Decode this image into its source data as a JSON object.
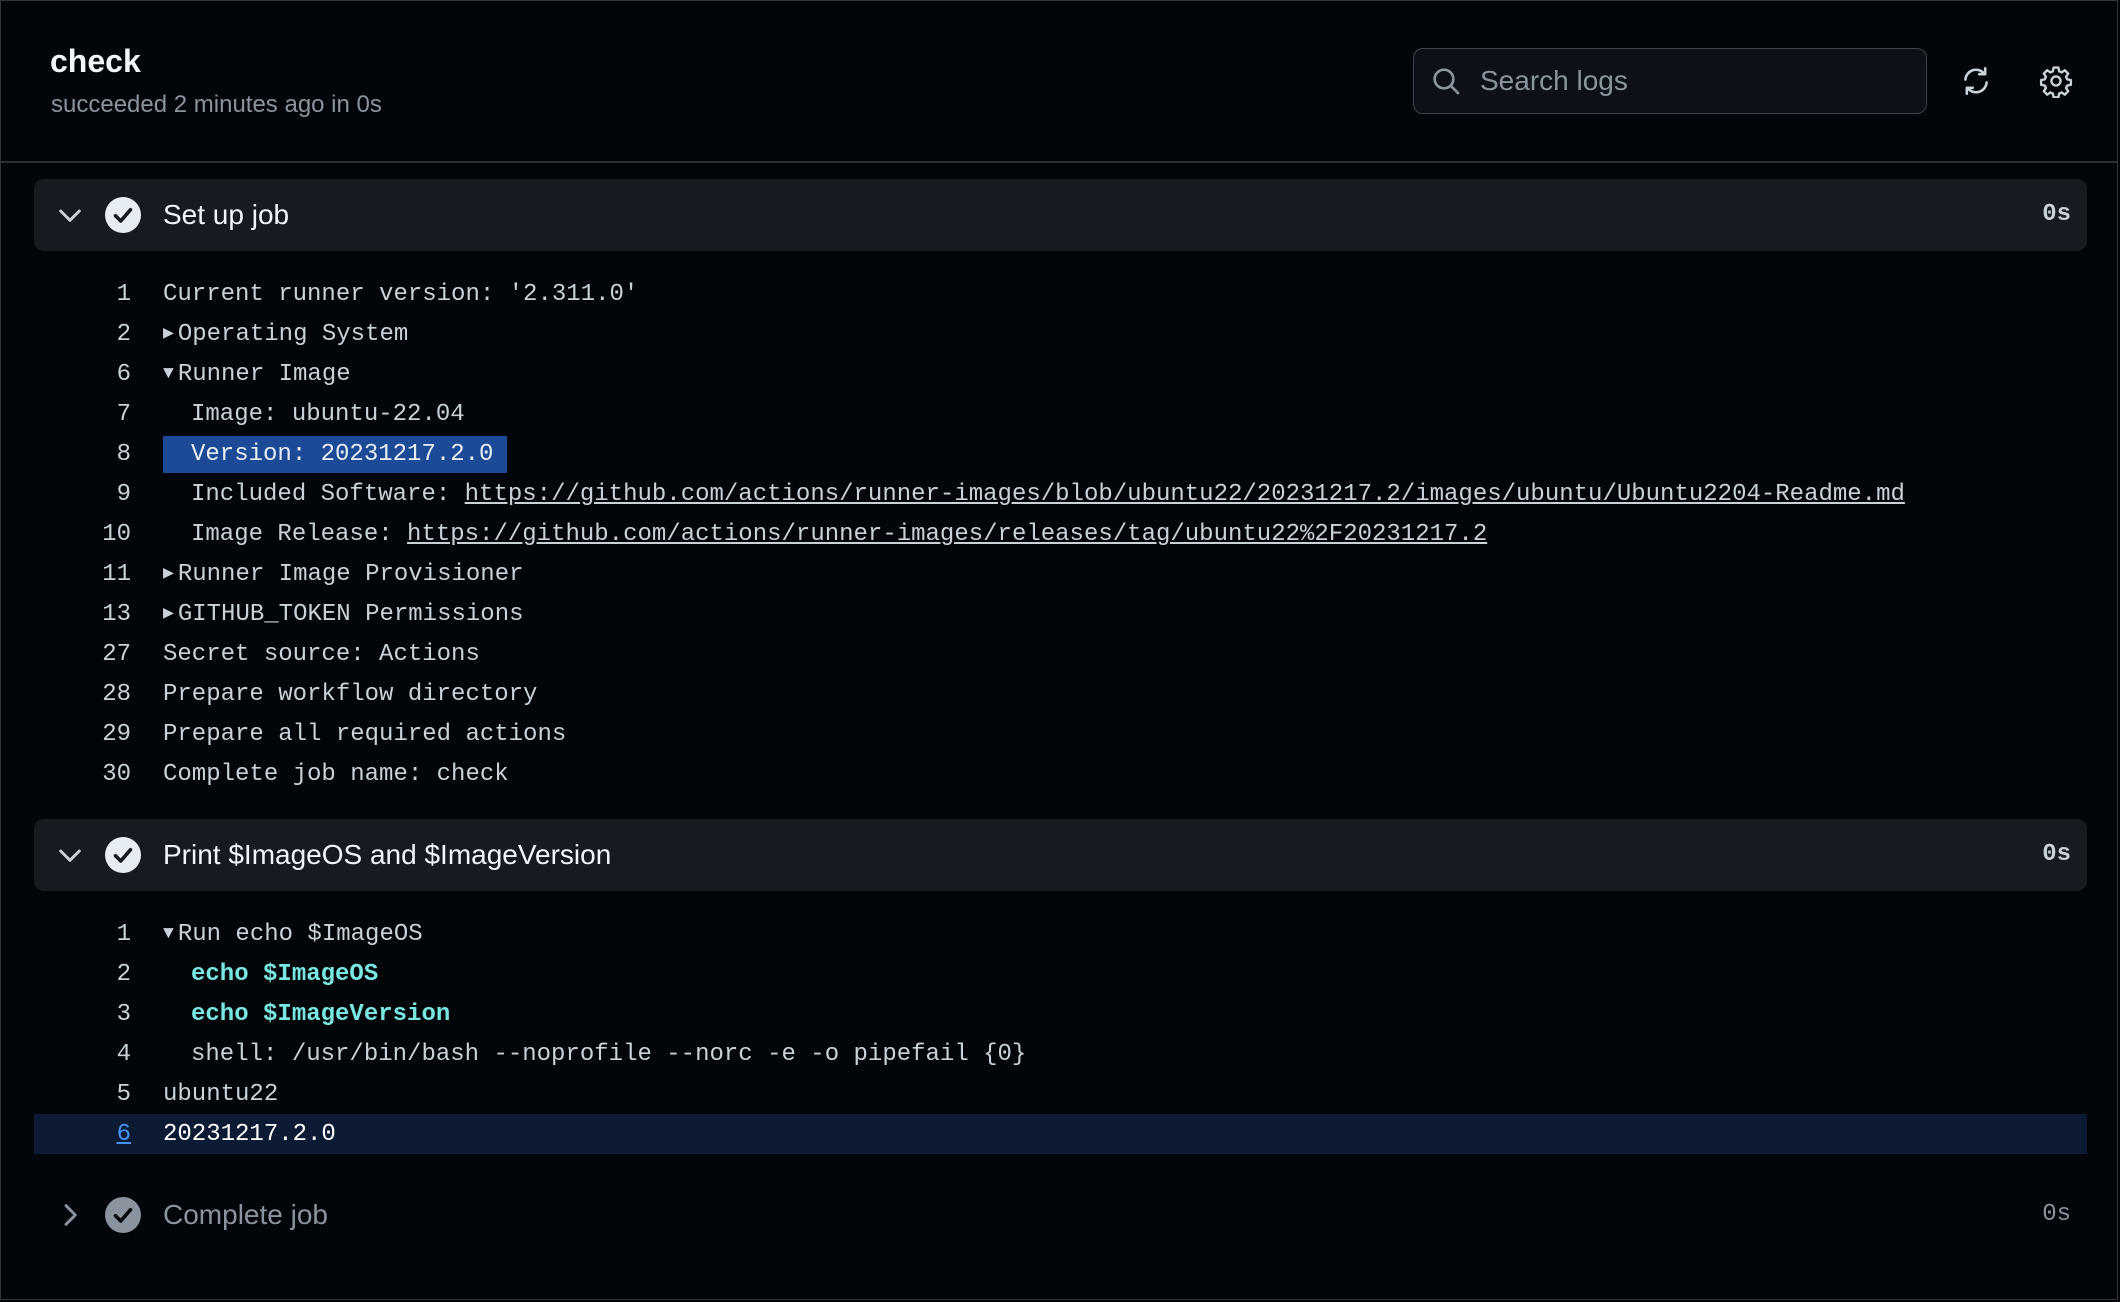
{
  "header": {
    "job_name": "check",
    "status_text": "succeeded 2 minutes ago in 0s",
    "search_placeholder": "Search logs",
    "icons": [
      "search-icon",
      "refresh-icon",
      "gear-icon"
    ]
  },
  "steps": [
    {
      "title": "Set up job",
      "duration": "0s",
      "expanded": true,
      "lines": [
        {
          "n": "1",
          "text": "Current runner version: '2.311.0'"
        },
        {
          "n": "2",
          "toggle": "▶",
          "text": "Operating System"
        },
        {
          "n": "6",
          "toggle": "▼",
          "text": "Runner Image"
        },
        {
          "n": "7",
          "text": "Image: ubuntu-22.04"
        },
        {
          "n": "8",
          "text": "Version: 20231217.2.0"
        },
        {
          "n": "9",
          "prefix": "Included Software: ",
          "link": "https://github.com/actions/runner-images/blob/ubuntu22/20231217.2/images/ubuntu/Ubuntu2204-Readme.md"
        },
        {
          "n": "10",
          "prefix": "Image Release: ",
          "link": "https://github.com/actions/runner-images/releases/tag/ubuntu22%2F20231217.2"
        },
        {
          "n": "11",
          "toggle": "▶",
          "text": "Runner Image Provisioner"
        },
        {
          "n": "13",
          "toggle": "▶",
          "text": "GITHUB_TOKEN Permissions"
        },
        {
          "n": "27",
          "text": "Secret source: Actions"
        },
        {
          "n": "28",
          "text": "Prepare workflow directory"
        },
        {
          "n": "29",
          "text": "Prepare all required actions"
        },
        {
          "n": "30",
          "text": "Complete job name: check"
        }
      ]
    },
    {
      "title": "Print $ImageOS and $ImageVersion",
      "duration": "0s",
      "expanded": true,
      "lines": [
        {
          "n": "1",
          "toggle": "▼",
          "text": "Run echo $ImageOS"
        },
        {
          "n": "2",
          "text": "echo $ImageOS"
        },
        {
          "n": "3",
          "text": "echo $ImageVersion"
        },
        {
          "n": "4",
          "text": "shell: /usr/bin/bash --noprofile --norc -e -o pipefail {0}"
        },
        {
          "n": "5",
          "text": "ubuntu22"
        },
        {
          "n": "6",
          "text": "20231217.2.0"
        }
      ]
    },
    {
      "title": "Complete job",
      "duration": "0s",
      "expanded": false
    }
  ],
  "colors": {
    "background": "#02050a",
    "step_header": "#161b22",
    "selection": "#1d4a96",
    "active_line": "#0d1a33",
    "command": "#79e6e0",
    "link_line_number": "#4493f8"
  }
}
